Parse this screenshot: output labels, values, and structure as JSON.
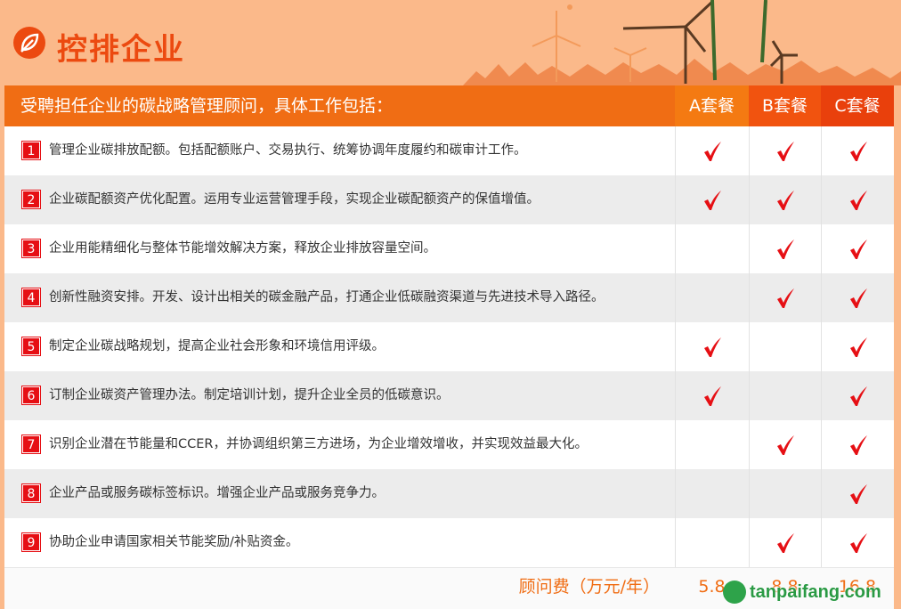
{
  "header": {
    "title": "控排企业"
  },
  "table": {
    "intro": "受聘担任企业的碳战略管理顾问，具体工作包括：",
    "plans": [
      "A套餐",
      "B套餐",
      "C套餐"
    ],
    "rows": [
      {
        "num": "1",
        "text": "管理企业碳排放配额。包括配额账户、交易执行、统筹协调年度履约和碳审计工作。",
        "a": true,
        "b": true,
        "c": true
      },
      {
        "num": "2",
        "text": "企业碳配额资产优化配置。运用专业运营管理手段，实现企业碳配额资产的保值增值。",
        "a": true,
        "b": true,
        "c": true
      },
      {
        "num": "3",
        "text": "企业用能精细化与整体节能增效解决方案，释放企业排放容量空间。",
        "a": false,
        "b": true,
        "c": true
      },
      {
        "num": "4",
        "text": "创新性融资安排。开发、设计出相关的碳金融产品，打通企业低碳融资渠道与先进技术导入路径。",
        "a": false,
        "b": true,
        "c": true
      },
      {
        "num": "5",
        "text": "制定企业碳战略规划，提高企业社会形象和环境信用评级。",
        "a": true,
        "b": false,
        "c": true
      },
      {
        "num": "6",
        "text": "订制企业碳资产管理办法。制定培训计划，提升企业全员的低碳意识。",
        "a": true,
        "b": false,
        "c": true
      },
      {
        "num": "7",
        "text": "识别企业潜在节能量和CCER，并协调组织第三方进场，为企业增效增收，并实现效益最大化。",
        "a": false,
        "b": true,
        "c": true
      },
      {
        "num": "8",
        "text": "企业产品或服务碳标签标识。增强企业产品或服务竞争力。",
        "a": false,
        "b": false,
        "c": true
      },
      {
        "num": "9",
        "text": "协助企业申请国家相关节能奖励/补贴资金。",
        "a": false,
        "b": true,
        "c": true
      }
    ],
    "fee": {
      "label": "顾问费（万元/年）",
      "a": "5.8",
      "b": "8.8",
      "c": "16.8"
    }
  },
  "watermark": {
    "text": "tanpaifang.com"
  },
  "colors": {
    "accent": "#f06d14",
    "check": "#e60f14",
    "background": "#fbb98a"
  }
}
